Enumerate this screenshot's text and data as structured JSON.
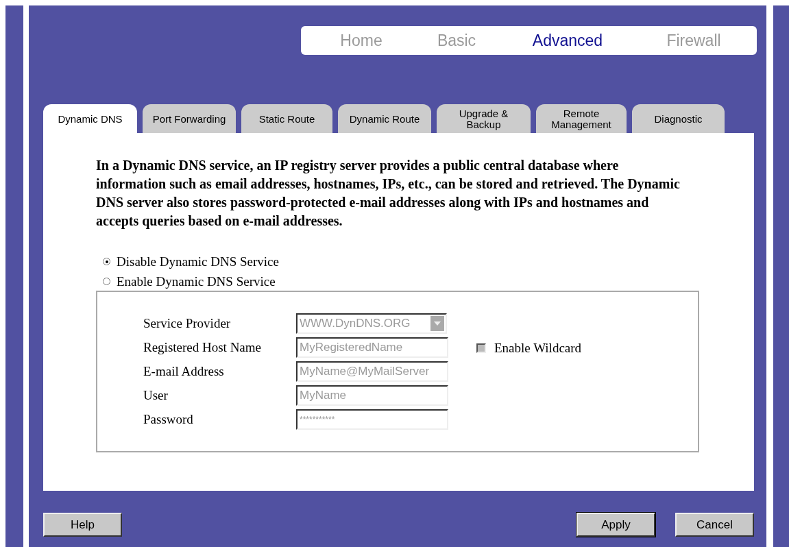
{
  "nav": [
    {
      "label": "Home",
      "selected": false
    },
    {
      "label": "Basic",
      "selected": false
    },
    {
      "label": "Advanced",
      "selected": true
    },
    {
      "label": "Firewall",
      "selected": false
    }
  ],
  "tabs": [
    {
      "label": "Dynamic DNS",
      "selected": true
    },
    {
      "label": "Port Forwarding",
      "selected": false
    },
    {
      "label": "Static Route",
      "selected": false
    },
    {
      "label": "Dynamic Route",
      "selected": false
    },
    {
      "label": "Upgrade & Backup",
      "selected": false
    },
    {
      "label": "Remote Management",
      "selected": false
    },
    {
      "label": "Diagnostic",
      "selected": false
    }
  ],
  "description": "In a Dynamic DNS service, an IP registry server provides a public central database where information such as email addresses, hostnames, IPs, etc., can be stored and retrieved. The Dynamic DNS server also stores password-protected e-mail addresses along with IPs and hostnames and accepts queries based on e-mail addresses.",
  "dns_mode": [
    {
      "label": "Disable Dynamic DNS Service",
      "selected": true
    },
    {
      "label": "Enable Dynamic DNS Service",
      "selected": false
    }
  ],
  "fields": [
    {
      "label": "Service Provider",
      "kind": "select",
      "value": "WWW.DynDNS.ORG",
      "disabled": true
    },
    {
      "label": "Registered Host Name",
      "kind": "text",
      "value": "MyRegisteredName",
      "disabled": true
    },
    {
      "label": "E-mail Address",
      "kind": "text",
      "value": "MyName@MyMailServer",
      "disabled": true
    },
    {
      "label": "User",
      "kind": "text",
      "value": "MyName",
      "disabled": true
    },
    {
      "label": "Password",
      "kind": "password",
      "value": "***********",
      "disabled": true
    }
  ],
  "wildcard": {
    "label": "Enable Wildcard",
    "checked": false,
    "disabled": true
  },
  "buttons": [
    {
      "label": "Help",
      "default": false
    },
    {
      "label": "Apply",
      "default": true
    },
    {
      "label": "Cancel",
      "default": false
    }
  ]
}
